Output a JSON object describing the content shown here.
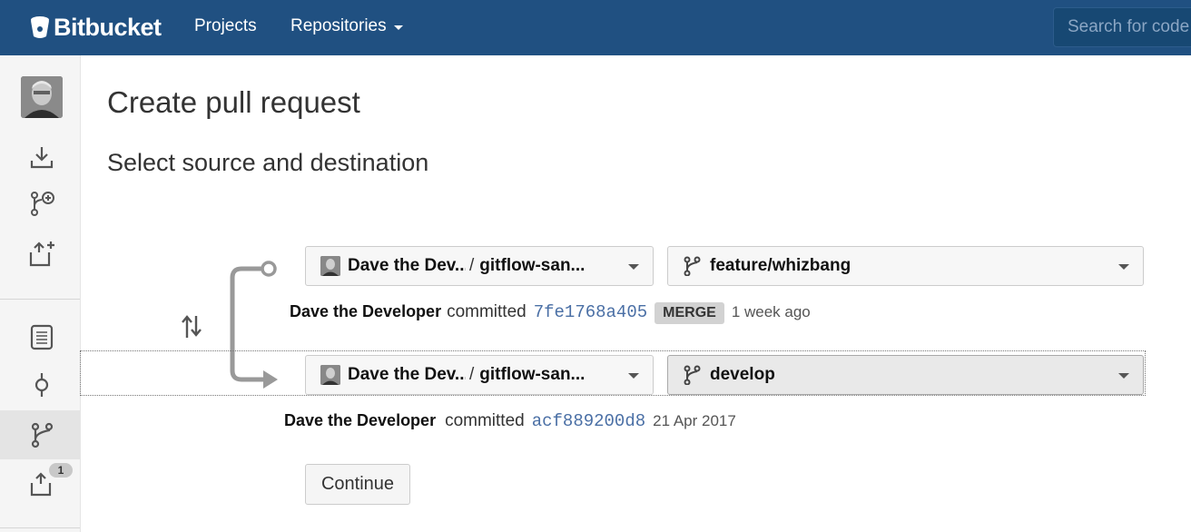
{
  "header": {
    "logo_text": "Bitbucket",
    "nav": {
      "projects_label": "Projects",
      "repositories_label": "Repositories"
    },
    "search_placeholder": "Search for code"
  },
  "sidebar": {
    "icons": [
      "clone-icon",
      "create-branch-icon",
      "create-pull-request-icon",
      "source-icon",
      "commits-icon",
      "branches-icon",
      "pull-requests-icon"
    ],
    "active_item": "branches",
    "pull_requests_badge": "1"
  },
  "main": {
    "title": "Create pull request",
    "subtitle": "Select source and destination",
    "source": {
      "repo_owner": "Dave the Dev...",
      "separator": "/",
      "repo_name": "gitflow-san...",
      "branch": "feature/whizbang",
      "commit": {
        "author": "Dave the Developer",
        "verb": "committed",
        "hash": "7fe1768a405",
        "badge": "MERGE",
        "date": "1 week ago"
      }
    },
    "destination": {
      "repo_owner": "Dave the Dev...",
      "separator": "/",
      "repo_name": "gitflow-san...",
      "branch": "develop",
      "commit": {
        "author": "Dave the Developer",
        "verb": "committed",
        "hash": "acf889200d8",
        "date": "21 Apr 2017"
      }
    },
    "continue_label": "Continue"
  },
  "colors": {
    "header_bg": "#205081",
    "hash_link": "#4a6fa5"
  }
}
